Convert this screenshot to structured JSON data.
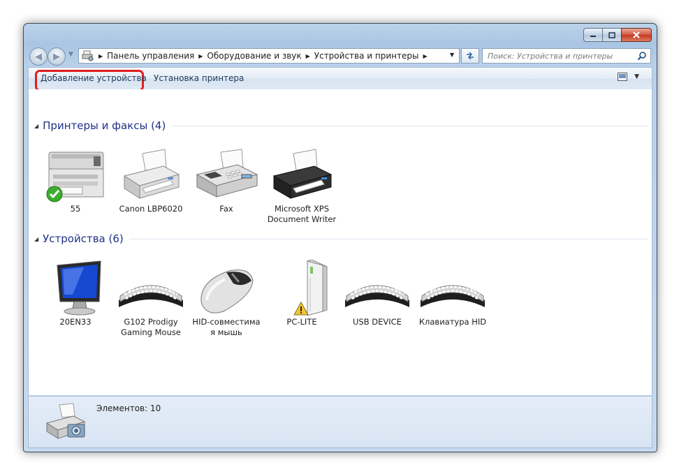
{
  "address": {
    "crumbs": [
      "Панель управления",
      "Оборудование и звук",
      "Устройства и принтеры"
    ]
  },
  "search": {
    "placeholder": "Поиск: Устройства и принтеры"
  },
  "toolbar": {
    "add_device": "Добавление устройства",
    "install_printer": "Установка принтера"
  },
  "groups": {
    "printers": {
      "title": "Принтеры и факсы (4)",
      "items": [
        {
          "line1": "55",
          "line2": "",
          "icon": "mfp-printer-icon",
          "badge": "default-check"
        },
        {
          "line1": "Canon LBP6020",
          "line2": "",
          "icon": "printer-icon"
        },
        {
          "line1": "Fax",
          "line2": "",
          "icon": "fax-icon"
        },
        {
          "line1": "Microsoft XPS",
          "line2": "Document Writer",
          "icon": "printer-icon"
        }
      ]
    },
    "devices": {
      "title": "Устройства (6)",
      "items": [
        {
          "line1": "20EN33",
          "line2": "",
          "icon": "monitor-icon"
        },
        {
          "line1": "G102 Prodigy",
          "line2": "Gaming Mouse",
          "icon": "keyboard-icon"
        },
        {
          "line1": "HID-совместима",
          "line2": "я мышь",
          "icon": "mouse-icon"
        },
        {
          "line1": "PC-LITE",
          "line2": "",
          "icon": "pc-tower-icon",
          "badge": "warning"
        },
        {
          "line1": "USB DEVICE",
          "line2": "",
          "icon": "keyboard-icon"
        },
        {
          "line1": "Клавиатура HID",
          "line2": "",
          "icon": "keyboard-icon"
        }
      ]
    }
  },
  "status": {
    "count_text": "Элементов: 10"
  },
  "colors": {
    "highlight": "#e31d1d",
    "group_title": "#1e3287",
    "close_button": "#c23a22"
  }
}
